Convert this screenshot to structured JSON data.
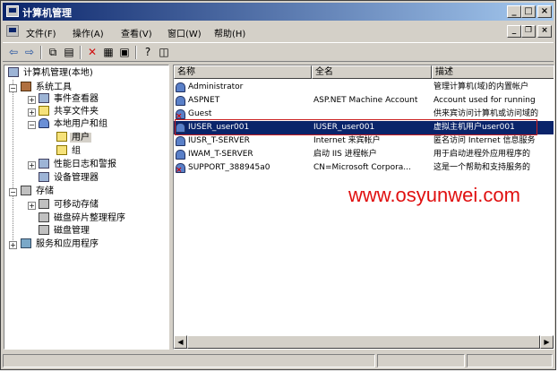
{
  "window": {
    "title": "计算机管理",
    "caption_buttons": {
      "minimize": "_",
      "maximize": "□",
      "close": "×"
    },
    "mdi_buttons": {
      "minimize": "_",
      "restore": "❐",
      "close": "×"
    }
  },
  "menu": {
    "items": [
      {
        "label": "文件(F)"
      },
      {
        "label": "操作(A)"
      },
      {
        "label": "查看(V)"
      },
      {
        "label": "窗口(W)"
      },
      {
        "label": "帮助(H)"
      }
    ]
  },
  "toolbar": {
    "icons": [
      "back-icon",
      "forward-icon",
      "up-folder-icon",
      "show-hide-tree-icon",
      "delete-icon",
      "properties-icon",
      "export-list-icon",
      "help-icon",
      "console-icon"
    ]
  },
  "tree": {
    "items": [
      {
        "label": "计算机管理(本地)",
        "icon": "computer-icon"
      },
      {
        "label": "系统工具",
        "icon": "tools-icon"
      },
      {
        "label": "事件查看器",
        "icon": "event-viewer-icon"
      },
      {
        "label": "共享文件夹",
        "icon": "shared-folder-icon"
      },
      {
        "label": "本地用户和组",
        "icon": "users-groups-icon"
      },
      {
        "label": "用户",
        "icon": "folder-icon"
      },
      {
        "label": "组",
        "icon": "folder-icon"
      },
      {
        "label": "性能日志和警报",
        "icon": "performance-icon"
      },
      {
        "label": "设备管理器",
        "icon": "device-manager-icon"
      },
      {
        "label": "存储",
        "icon": "storage-icon"
      },
      {
        "label": "可移动存储",
        "icon": "removable-storage-icon"
      },
      {
        "label": "磁盘碎片整理程序",
        "icon": "defrag-icon"
      },
      {
        "label": "磁盘管理",
        "icon": "disk-management-icon"
      },
      {
        "label": "服务和应用程序",
        "icon": "services-icon"
      }
    ]
  },
  "list": {
    "columns": [
      "名称",
      "全名",
      "描述"
    ],
    "rows": [
      {
        "name": "Administrator",
        "fullname": "",
        "desc": "管理计算机(域)的内置帐户"
      },
      {
        "name": "ASPNET",
        "fullname": "ASP.NET Machine Account",
        "desc": "Account used for running"
      },
      {
        "name": "Guest",
        "fullname": "",
        "desc": "供来宾访问计算机或访问域的"
      },
      {
        "name": "IUSER_user001",
        "fullname": "IUSER_user001",
        "desc": "虚拟主机用户user001"
      },
      {
        "name": "IUSR_T-SERVER",
        "fullname": "Internet 来宾帐户",
        "desc": "匿名访问 Internet 信息服务"
      },
      {
        "name": "IWAM_T-SERVER",
        "fullname": "启动 IIS 进程帐户",
        "desc": "用于启动进程外应用程序的"
      },
      {
        "name": "SUPPORT_388945a0",
        "fullname": "CN=Microsoft Corpora...",
        "desc": "这是一个帮助和支持服务的"
      }
    ]
  },
  "watermark": "www.osyunwei.com",
  "colors": {
    "selection": "#0a246a",
    "title_gradient_start": "#0a246a",
    "title_gradient_end": "#a6caf0",
    "annotation": "#cc2020"
  }
}
